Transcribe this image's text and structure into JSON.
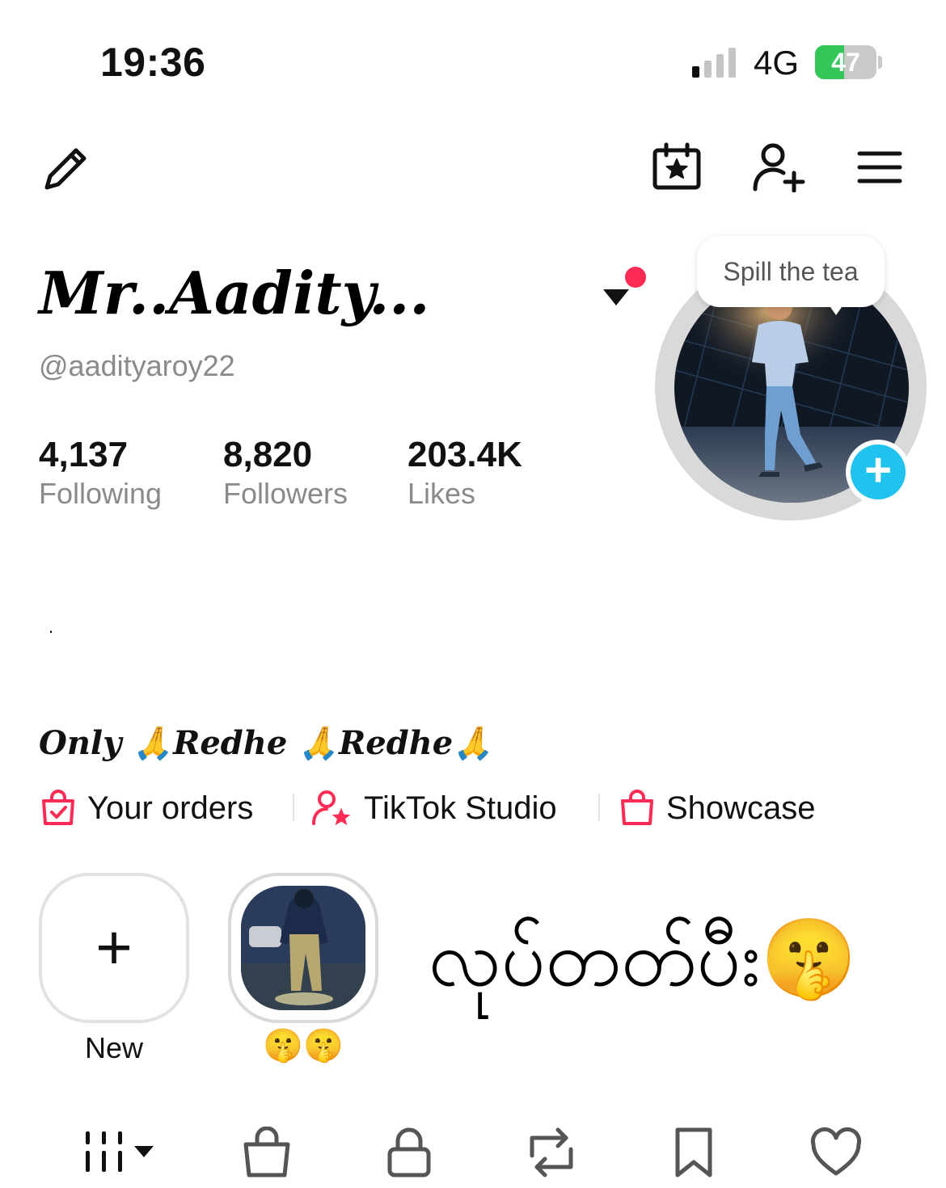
{
  "status_bar": {
    "time": "19:36",
    "network": "4G",
    "battery": "47",
    "battery_level_percent": 47,
    "battery_color": "#33c759"
  },
  "toolbar": {
    "left_icon": "pencil-icon",
    "right_icons": [
      "calendar-star-icon",
      "add-friend-icon",
      "menu-icon"
    ]
  },
  "profile": {
    "display_name": "Mr..Aadity...",
    "username": "@aadityaroy22",
    "notification_dot_color": "#fe2c55",
    "avatar_bubble": "Spill the tea"
  },
  "stats": [
    {
      "value": "4,137",
      "label": "Following"
    },
    {
      "value": "8,820",
      "label": "Followers"
    },
    {
      "value": "203.4K",
      "label": "Likes"
    }
  ],
  "bio": {
    "line1": "",
    "line2": ".",
    "line3": "",
    "quote": " Only 🙏Redhe 🙏Redhe🙏"
  },
  "links": [
    {
      "label": "Your orders",
      "icon": "orders-bag-icon"
    },
    {
      "label": "TikTok Studio",
      "icon": "studio-person-star-icon"
    },
    {
      "label": "Showcase",
      "icon": "showcase-bag-icon"
    }
  ],
  "links_color": "#fe2c55",
  "highlights": {
    "new_plus": "+",
    "new_label": "New",
    "item_label": "🤫🤫",
    "text": "လုပ်တတ်ပီး🤫"
  },
  "accent_color": "#20c3ed",
  "tabs": [
    "videos-grid-icon",
    "shop-bag-icon",
    "lock-icon",
    "repost-icon",
    "bookmark-icon",
    "heart-icon"
  ]
}
